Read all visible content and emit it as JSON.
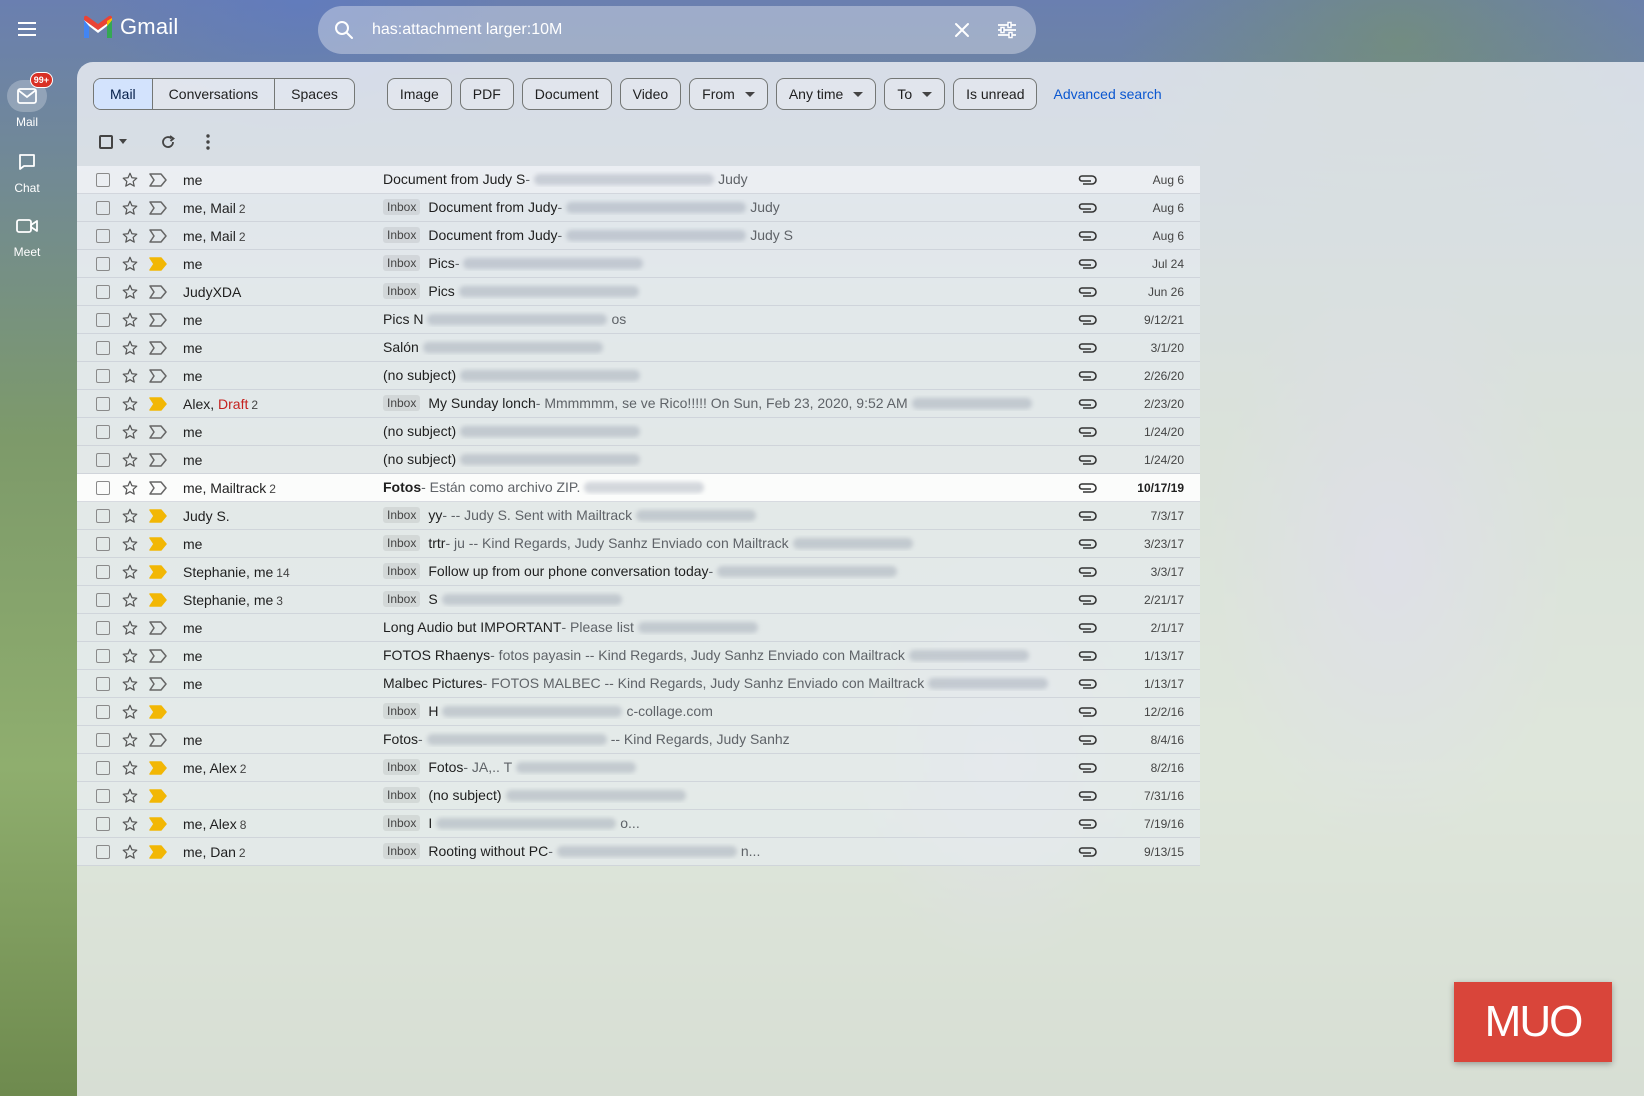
{
  "app": {
    "name": "Gmail"
  },
  "nav": {
    "mail_label": "Mail",
    "mail_badge": "99+",
    "chat_label": "Chat",
    "meet_label": "Meet"
  },
  "search": {
    "value": "has:attachment larger:10M"
  },
  "filters": {
    "segments": [
      "Mail",
      "Conversations",
      "Spaces"
    ],
    "chips": [
      "Image",
      "PDF",
      "Document",
      "Video"
    ],
    "dropdowns": [
      "From",
      "Any time",
      "To"
    ],
    "is_unread": "Is unread",
    "advanced": "Advanced search"
  },
  "emails": [
    {
      "sender": "me",
      "count": "",
      "label": "",
      "subject": "Document from Judy S",
      "snippet": " - ",
      "tail": "Judy",
      "date": "Aug 6",
      "imp": false,
      "unread": false
    },
    {
      "sender": "me, Mail",
      "count": "2",
      "label": "Inbox",
      "subject": "Document from Judy",
      "snippet": " - ",
      "tail": "Judy",
      "date": "Aug 6",
      "imp": false,
      "unread": false
    },
    {
      "sender": "me, Mail",
      "count": "2",
      "label": "Inbox",
      "subject": "Document from Judy",
      "snippet": " - ",
      "tail": "Judy S",
      "date": "Aug 6",
      "imp": false,
      "unread": false
    },
    {
      "sender": "me",
      "count": "",
      "label": "Inbox",
      "subject": "Pics",
      "snippet": " - ",
      "tail": "",
      "date": "Jul 24",
      "imp": true,
      "unread": false
    },
    {
      "sender": "JudyXDA",
      "count": "",
      "label": "Inbox",
      "subject": "Pics",
      "snippet": "",
      "tail": "",
      "date": "Jun 26",
      "imp": false,
      "unread": false
    },
    {
      "sender": "me",
      "count": "",
      "label": "",
      "subject": "Pics N",
      "snippet": "",
      "tail": "os",
      "date": "9/12/21",
      "imp": false,
      "unread": false
    },
    {
      "sender": "me",
      "count": "",
      "label": "",
      "subject": "Salón",
      "snippet": "",
      "tail": "",
      "date": "3/1/20",
      "imp": false,
      "unread": false
    },
    {
      "sender": "me",
      "count": "",
      "label": "",
      "subject": "(no subject)",
      "snippet": "",
      "tail": "",
      "date": "2/26/20",
      "imp": false,
      "unread": false
    },
    {
      "sender": "Alex, Draft",
      "count": "2",
      "label": "Inbox",
      "subject": "My Sunday lonch",
      "snippet": " - Mmmmmm, se ve Rico!!!!! On Sun, Feb 23, 2020, 9:52 AM",
      "tail": "",
      "date": "2/23/20",
      "imp": true,
      "unread": false
    },
    {
      "sender": "me",
      "count": "",
      "label": "",
      "subject": "(no subject)",
      "snippet": "",
      "tail": "",
      "date": "1/24/20",
      "imp": false,
      "unread": false
    },
    {
      "sender": "me",
      "count": "",
      "label": "",
      "subject": "(no subject)",
      "snippet": "",
      "tail": "",
      "date": "1/24/20",
      "imp": false,
      "unread": false
    },
    {
      "sender": "me, Mailtrack",
      "count": "2",
      "label": "",
      "subject": "Fotos",
      "snippet": " - Están como archivo ZIP.",
      "tail": "",
      "date": "10/17/19",
      "imp": false,
      "unread": true
    },
    {
      "sender": "Judy S.",
      "count": "",
      "label": "Inbox",
      "subject": "yy",
      "snippet": " - -- Judy S. Sent with Mailtrack",
      "tail": "",
      "date": "7/3/17",
      "imp": true,
      "unread": false
    },
    {
      "sender": "me",
      "count": "",
      "label": "Inbox",
      "subject": "trtr",
      "snippet": " - ju -- Kind Regards, Judy Sanhz Enviado con Mailtrack",
      "tail": "",
      "date": "3/23/17",
      "imp": true,
      "unread": false
    },
    {
      "sender": "Stephanie, me",
      "count": "14",
      "label": "Inbox",
      "subject": "Follow up from our phone conversation today",
      "snippet": " - ",
      "tail": "",
      "date": "3/3/17",
      "imp": true,
      "unread": false
    },
    {
      "sender": "Stephanie, me",
      "count": "3",
      "label": "Inbox",
      "subject": "S",
      "snippet": "",
      "tail": "",
      "date": "2/21/17",
      "imp": true,
      "unread": false
    },
    {
      "sender": "me",
      "count": "",
      "label": "",
      "subject": "Long Audio but IMPORTANT",
      "snippet": " - Please list",
      "tail": "",
      "date": "2/1/17",
      "imp": false,
      "unread": false
    },
    {
      "sender": "me",
      "count": "",
      "label": "",
      "subject": "FOTOS Rhaenys",
      "snippet": " - fotos payasin -- Kind Regards, Judy Sanhz Enviado con Mailtrack",
      "tail": "",
      "date": "1/13/17",
      "imp": false,
      "unread": false
    },
    {
      "sender": "me",
      "count": "",
      "label": "",
      "subject": "Malbec Pictures",
      "snippet": " - FOTOS MALBEC -- Kind Regards, Judy Sanhz Enviado con Mailtrack",
      "tail": "",
      "date": "1/13/17",
      "imp": false,
      "unread": false
    },
    {
      "sender": "",
      "count": "",
      "label": "Inbox",
      "subject": "H",
      "snippet": "",
      "tail": "c-collage.com",
      "date": "12/2/16",
      "imp": true,
      "unread": false
    },
    {
      "sender": "me",
      "count": "",
      "label": "",
      "subject": "Fotos",
      "snippet": " - ",
      "tail": "-- Kind Regards, Judy Sanhz",
      "date": "8/4/16",
      "imp": false,
      "unread": false
    },
    {
      "sender": "me, Alex",
      "count": "2",
      "label": "Inbox",
      "subject": "Fotos",
      "snippet": " - JA,.. T",
      "tail": "",
      "date": "8/2/16",
      "imp": true,
      "unread": false
    },
    {
      "sender": "",
      "count": "",
      "label": "Inbox",
      "subject": "(no subject)",
      "snippet": "",
      "tail": "",
      "date": "7/31/16",
      "imp": true,
      "unread": false
    },
    {
      "sender": "me, Alex",
      "count": "8",
      "label": "Inbox",
      "subject": "I",
      "snippet": "",
      "tail": "o...",
      "date": "7/19/16",
      "imp": true,
      "unread": false
    },
    {
      "sender": "me, Dan",
      "count": "2",
      "label": "Inbox",
      "subject": "Rooting without PC",
      "snippet": " - ",
      "tail": "n...",
      "date": "9/13/15",
      "imp": true,
      "unread": false
    }
  ],
  "watermark": "MUO"
}
